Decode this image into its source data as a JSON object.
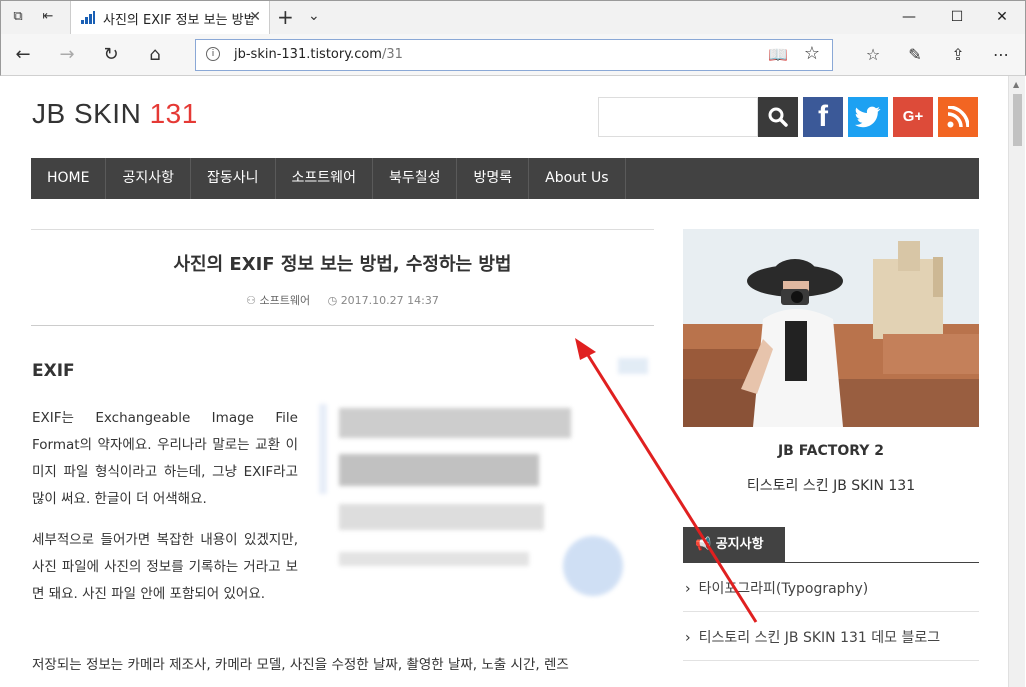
{
  "browser": {
    "tab_title": "사진의 EXIF 정보 보는 방법",
    "url_host": "jb-skin-131.tistory.com",
    "url_path": "/31",
    "icons": [
      "tabs-icon",
      "back-tabs-icon",
      "close-icon",
      "plus-icon",
      "chevron-down-icon",
      "minimize-icon",
      "maximize-icon",
      "window-close-icon",
      "back-arrow-icon",
      "forward-arrow-icon",
      "refresh-icon",
      "home-icon",
      "info-icon",
      "reading-view-icon",
      "favorite-star-icon",
      "favorites-list-icon",
      "pen-icon",
      "share-icon",
      "more-icon"
    ]
  },
  "site": {
    "logo_main": "JB SKIN",
    "logo_num": "131",
    "logo_num_color": "#e53935",
    "social": [
      {
        "name": "facebook",
        "glyph": "f",
        "color": "#3b5998"
      },
      {
        "name": "twitter",
        "glyph": "🐦",
        "color": "#1da1f2"
      },
      {
        "name": "google-plus",
        "glyph": "G+",
        "color": "#dd4b39"
      },
      {
        "name": "rss",
        "glyph": "◉",
        "color": "#f26522"
      }
    ]
  },
  "menu": [
    "HOME",
    "공지사항",
    "잡동사니",
    "소프트웨어",
    "북두칠성",
    "방명록",
    "About Us"
  ],
  "post": {
    "title": "사진의 EXIF 정보 보는 방법, 수정하는 방법",
    "category": "소프트웨어",
    "date": "2017.10.27 14:37",
    "heading": "EXIF",
    "p1": "EXIF는 Exchangeable Image File Format의 약자에요. 우리나라 말로는 교환 이미지 파일 형식이라고 하는데, 그냥 EXIF라고 많이 써요. 한글이 더 어색해요.",
    "p2": "세부적으로 들어가면 복잡한 내용이 있겠지만, 사진 파일에 사진의 정보를 기록하는 거라고 보면 돼요. 사진 파일 안에 포함되어 있어요.",
    "p3": "저장되는 정보는 카메라 제조사, 카메라 모델, 사진을 수정한 날짜, 촬영한 날짜, 노출 시간, 렌즈"
  },
  "sidebar": {
    "name": "JB FACTORY 2",
    "desc": "티스토리 스킨 JB SKIN 131",
    "notice_label": "공지사항",
    "notices": [
      "타이포그라피(Typography)",
      "티스토리 스킨 JB SKIN 131 데모 블로그"
    ]
  },
  "colors": {
    "menu_bg": "#424242",
    "annotation_arrow": "#e02020"
  }
}
